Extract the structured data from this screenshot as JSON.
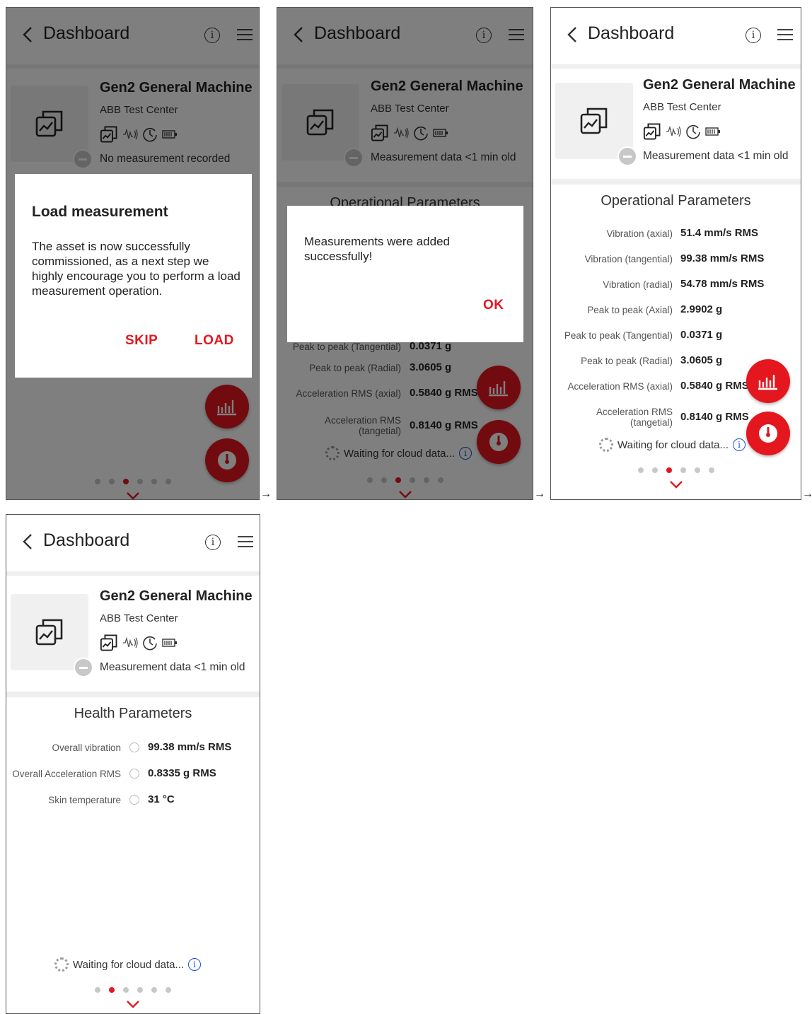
{
  "header": {
    "title": "Dashboard",
    "info_glyph": "i"
  },
  "asset": {
    "name": "Gen2 General Machine",
    "site": "ABB Test Center",
    "status_none": "No measurement recorded",
    "status_recent": "Measurement data <1 min old"
  },
  "colors": {
    "accent": "#e4171f",
    "info_blue": "#1a4fd6",
    "scrim": "rgba(0,0,0,0.5)"
  },
  "icons": [
    "back-chevron-icon",
    "info-icon",
    "hamburger-menu-icon",
    "asset-trend-icon",
    "vibration-icon",
    "clock-icon",
    "battery-icon",
    "bar-chart-icon",
    "gauge-icon",
    "chevron-down-icon"
  ],
  "dialog_load": {
    "title": "Load measurement",
    "body": "The asset is now successfully commissioned, as a next step we highly encourage you to perform a load measurement operation.",
    "skip": "SKIP",
    "load": "LOAD"
  },
  "dialog_success": {
    "body": "Measurements were added successfully!",
    "ok": "OK"
  },
  "operational": {
    "title": "Operational Parameters",
    "rows": [
      {
        "label": "Vibration (axial)",
        "value": "51.4 mm/s RMS"
      },
      {
        "label": "Vibration (tangential)",
        "value": "99.38 mm/s RMS"
      },
      {
        "label": "Vibration (radial)",
        "value": "54.78 mm/s RMS"
      },
      {
        "label": "Peak to peak (Axial)",
        "value": "2.9902 g"
      },
      {
        "label": "Peak to peak (Tangential)",
        "value": "0.0371 g"
      },
      {
        "label": "Peak to peak (Radial)",
        "value": "3.0605 g"
      },
      {
        "label": "Acceleration RMS (axial)",
        "value": "0.5840 g RMS"
      },
      {
        "label": "Acceleration RMS (tangetial)",
        "value": "0.8140 g RMS"
      }
    ]
  },
  "health": {
    "title": "Health Parameters",
    "rows": [
      {
        "label": "Overall vibration",
        "value": "99.38 mm/s RMS"
      },
      {
        "label": "Overall Acceleration RMS",
        "value": "0.8335 g RMS"
      },
      {
        "label": "Skin temperature",
        "value": "31 °C"
      }
    ]
  },
  "waiting": "Waiting for cloud data...",
  "pagination": {
    "count": 6,
    "active_frames_1_3": 3,
    "active_frame_4": 2
  },
  "flow_arrow": "→"
}
